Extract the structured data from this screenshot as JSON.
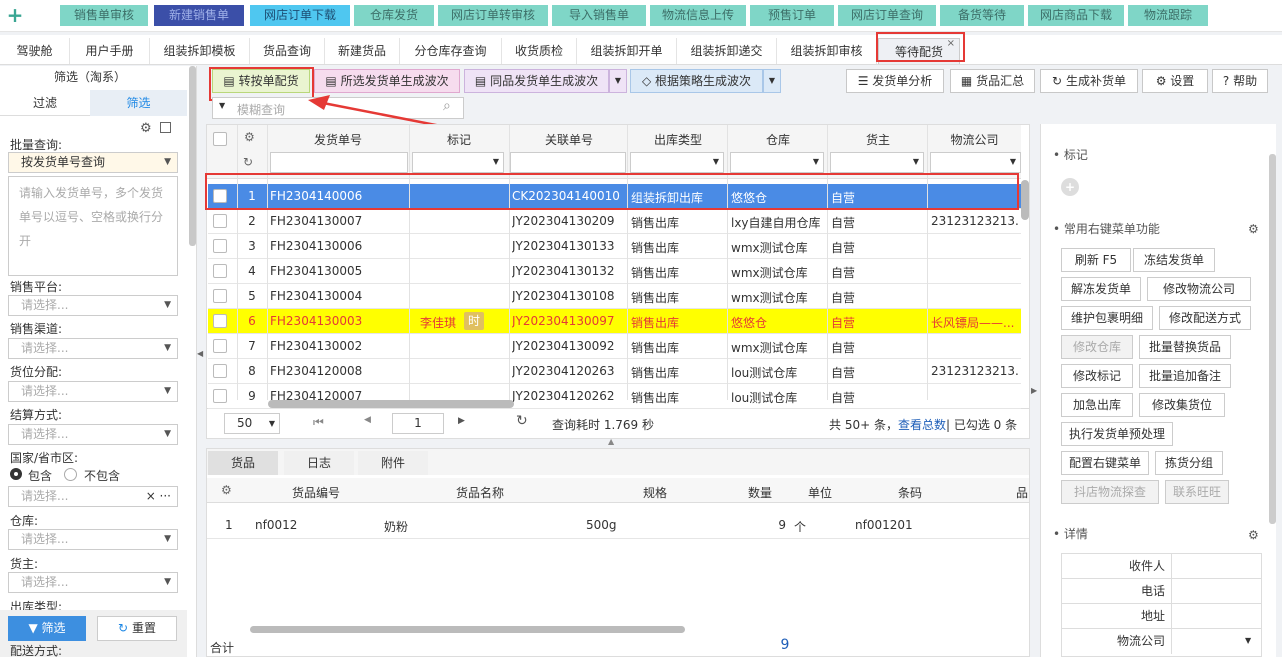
{
  "topnav": [
    "销售单审核",
    "新建销售单",
    "网店订单下载",
    "仓库发货",
    "网店订单转审核",
    "导入销售单",
    "物流信息上传",
    "预售订单",
    "网店订单查询",
    "备货等待",
    "网店商品下载",
    "物流跟踪"
  ],
  "subtabs": [
    "驾驶舱",
    "用户手册",
    "组装拆卸模板",
    "货品查询",
    "新建货品",
    "分仓库存查询",
    "收货质检",
    "组装拆卸开单",
    "组装拆卸递交",
    "组装拆卸审核",
    "等待配货"
  ],
  "sidebar": {
    "title": "筛选（淘系）",
    "tab_filter": "过滤",
    "tab_screen": "筛选",
    "batch_label": "批量查询:",
    "batch_value": "按发货单号查询",
    "batch_placeholder": "请输入发货单号，多个发货单号以逗号、空格或换行分开",
    "platform": "销售平台:",
    "channel": "销售渠道:",
    "alloc": "货位分配:",
    "settle": "结算方式:",
    "region": "国家/省市区:",
    "include": "包含",
    "exclude": "不包含",
    "warehouse": "仓库:",
    "owner": "货主:",
    "outtype": "出库类型:",
    "delivery": "配送方式:",
    "placeholder": "请选择...",
    "btn_filter": "筛选",
    "btn_reset": "重置"
  },
  "toolbar": {
    "b1": "转按单配货",
    "b2": "所选发货单生成波次",
    "b3": "同品发货单生成波次",
    "b4": "根据策略生成波次",
    "b5": "发货单分析",
    "b6": "货品汇总",
    "b7": "生成补货单",
    "b8": "设置",
    "b9": "帮助",
    "search_placeholder": "模糊查询"
  },
  "grid": {
    "headers": [
      "发货单号",
      "标记",
      "关联单号",
      "出库类型",
      "仓库",
      "货主",
      "物流公司"
    ],
    "rows": [
      {
        "n": "1",
        "no": "FH2304140006",
        "mark": "",
        "rel": "CK202304140010",
        "type": "组装拆卸出库",
        "wh": "悠悠仓",
        "owner": "自营",
        "log": ""
      },
      {
        "n": "2",
        "no": "FH2304130007",
        "mark": "",
        "rel": "JY202304130209",
        "type": "销售出库",
        "wh": "lxy自建自用仓库",
        "owner": "自营",
        "log": "23123123213..."
      },
      {
        "n": "3",
        "no": "FH2304130006",
        "mark": "",
        "rel": "JY202304130133",
        "type": "销售出库",
        "wh": "wmx测试仓库",
        "owner": "自营",
        "log": ""
      },
      {
        "n": "4",
        "no": "FH2304130005",
        "mark": "",
        "rel": "JY202304130132",
        "type": "销售出库",
        "wh": "wmx测试仓库",
        "owner": "自营",
        "log": ""
      },
      {
        "n": "5",
        "no": "FH2304130004",
        "mark": "",
        "rel": "JY202304130108",
        "type": "销售出库",
        "wh": "wmx测试仓库",
        "owner": "自营",
        "log": ""
      },
      {
        "n": "6",
        "no": "FH2304130003",
        "mark": "李佳琪",
        "rel": "JY202304130097",
        "type": "销售出库",
        "wh": "悠悠仓",
        "owner": "自营",
        "log": "长风镖局——..."
      },
      {
        "n": "7",
        "no": "FH2304130002",
        "mark": "",
        "rel": "JY202304130092",
        "type": "销售出库",
        "wh": "wmx测试仓库",
        "owner": "自营",
        "log": ""
      },
      {
        "n": "8",
        "no": "FH2304120008",
        "mark": "",
        "rel": "JY202304120263",
        "type": "销售出库",
        "wh": "lou测试仓库",
        "owner": "自营",
        "log": "23123123213..."
      },
      {
        "n": "9",
        "no": "FH2304120007",
        "mark": "",
        "rel": "JY202304120262",
        "type": "销售出库",
        "wh": "lou测试仓库",
        "owner": "自营",
        "log": ""
      }
    ],
    "mark_badge": "时",
    "page_size": "50",
    "page": "1",
    "query_time": "查询耗时 1.769 秒",
    "total_prefix": "共 50+ 条，",
    "total_link": "查看总数",
    "selected": "| 已勾选 0 条"
  },
  "detail": {
    "tabs": [
      "货品",
      "日志",
      "附件"
    ],
    "headers": [
      "货品编号",
      "货品名称",
      "规格",
      "数量",
      "单位",
      "条码",
      "品"
    ],
    "row": {
      "n": "1",
      "code": "nf0012",
      "name": "奶粉",
      "spec": "500g",
      "qty": "9",
      "unit": "个",
      "barcode": "nf001201"
    },
    "sum_label": "合计",
    "sum_qty": "9"
  },
  "right": {
    "mark": "标记",
    "common": "常用右键菜单功能",
    "buttons": [
      "刷新 F5",
      "冻结发货单",
      "解冻发货单",
      "修改物流公司",
      "维护包裹明细",
      "修改配送方式",
      "修改仓库",
      "批量替换货品",
      "修改标记",
      "批量追加备注",
      "加急出库",
      "修改集货位",
      "执行发货单预处理",
      "配置右键菜单",
      "拣货分组",
      "抖店物流探查",
      "联系旺旺"
    ],
    "detail": "详情",
    "fields": [
      "收件人",
      "电话",
      "地址",
      "物流公司"
    ]
  }
}
